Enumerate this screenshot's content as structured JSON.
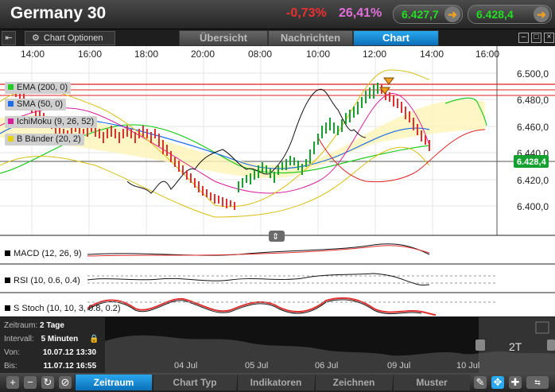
{
  "header": {
    "title": "Germany 30",
    "change": "-0,73%",
    "change_pct2": "26,41%",
    "sell_price": "6.427,7",
    "buy_price": "6.428,4"
  },
  "toolbar": {
    "options_label": "Chart Optionen",
    "tabs": [
      "Übersicht",
      "Nachrichten",
      "Chart"
    ]
  },
  "chart": {
    "time_labels": [
      "14:00",
      "16:00",
      "18:00",
      "20:00",
      "08:00",
      "10:00",
      "12:00",
      "14:00",
      "16:00"
    ],
    "price_labels": [
      "6.500,0",
      "6.480,0",
      "6.460,0",
      "6.440,0",
      "6.420,0",
      "6.400,0"
    ],
    "current_price": "6.428,4",
    "legend": [
      {
        "label": "EMA (200, 0)",
        "color": "#22cc22"
      },
      {
        "label": "SMA (50, 0)",
        "color": "#1e6de8"
      },
      {
        "label": "IchiMoku (9, 26, 52)",
        "color": "#d81e9a"
      },
      {
        "label": "B Bänder (20, 2)",
        "color": "#e8d210"
      }
    ]
  },
  "panels": {
    "macd": "MACD (12, 26, 9)",
    "rsi": "RSI (10, 0.6, 0.4)",
    "stoch": "S Stoch (10, 10, 3, 0.8, 0.2)"
  },
  "info": {
    "zeitraum_label": "Zeitraum:",
    "zeitraum_value": "2 Tage",
    "intervall_label": "Intervall:",
    "intervall_value": "5 Minuten",
    "von_label": "Von:",
    "von_value": "10.07.12 13:30",
    "bis_label": "Bis:",
    "bis_value": "11.07.12 16:55"
  },
  "navigator": {
    "dates": [
      "04 Jul",
      "05 Jul",
      "06 Jul",
      "09 Jul",
      "10 Jul"
    ],
    "range_label": "2T"
  },
  "bottom_tabs": [
    "Zeitraum",
    "Chart Typ",
    "Indikatoren",
    "Zeichnen",
    "Muster"
  ]
}
